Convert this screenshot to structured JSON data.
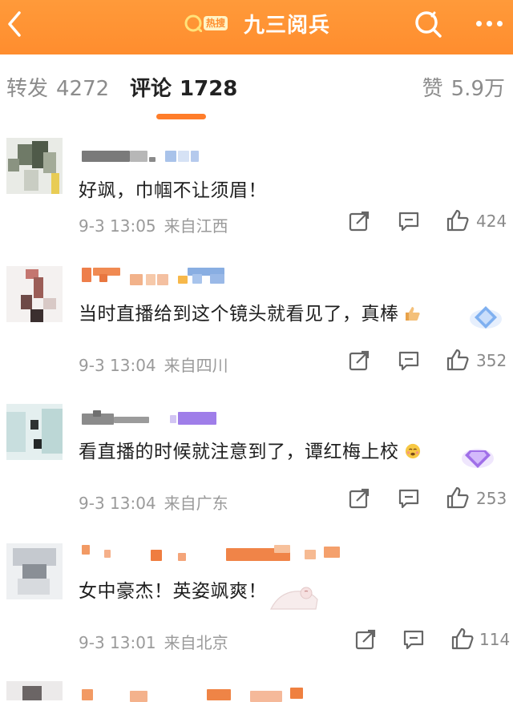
{
  "header": {
    "title": "九三阅兵",
    "logo_text": "热搜"
  },
  "tabs": {
    "repost": {
      "label": "转发",
      "count": "4272"
    },
    "comment": {
      "label": "评论",
      "count": "1728"
    },
    "like": {
      "label": "赞",
      "count": "5.9万"
    }
  },
  "comments": [
    {
      "text": "好飒，巾帼不让须眉！",
      "time": "9-3 13:05",
      "location": "来自江西",
      "likes": "424"
    },
    {
      "text": "当时直播给到这个镜头就看见了，真棒",
      "time": "9-3 13:04",
      "location": "来自四川",
      "likes": "352"
    },
    {
      "text": "看直播的时候就注意到了，谭红梅上校",
      "time": "9-3 13:04",
      "location": "来自广东",
      "likes": "253"
    },
    {
      "text": "女中豪杰！英姿飒爽！",
      "time": "9-3 13:01",
      "location": "来自北京",
      "likes": "114"
    }
  ],
  "colors": {
    "accent": "#ff8d2e",
    "underline": "#ff7d2a"
  },
  "icons": [
    "back-icon",
    "search-icon",
    "more-icon",
    "share-icon",
    "comment-icon",
    "like-icon"
  ]
}
